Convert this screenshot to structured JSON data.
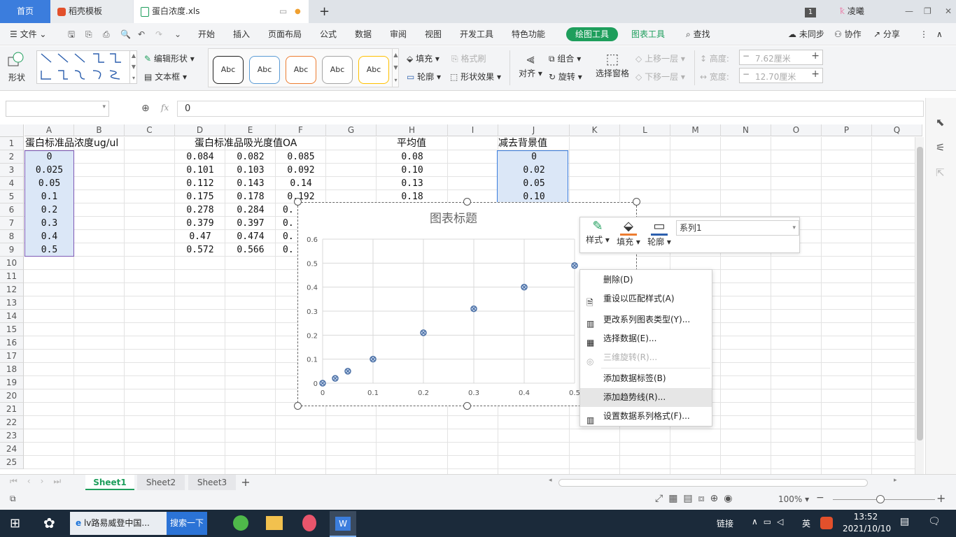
{
  "tabs": {
    "home": "首页",
    "template": "稻壳模板",
    "file": "蛋白浓度.xls",
    "user": "凌曦",
    "badge": "1"
  },
  "menubar": {
    "file": "文件",
    "items": [
      "开始",
      "插入",
      "页面布局",
      "公式",
      "数据",
      "审阅",
      "视图",
      "开发工具",
      "特色功能"
    ],
    "drawing_tools": "绘图工具",
    "chart_tools": "图表工具",
    "search": "查找",
    "sync": "未同步",
    "collab": "协作",
    "share": "分享"
  },
  "ribbon": {
    "shape": "形状",
    "edit_shape": "编辑形状",
    "textbox": "文本框",
    "style_samples": [
      "Abc",
      "Abc",
      "Abc",
      "Abc",
      "Abc"
    ],
    "fill": "填充",
    "format_painter": "格式刷",
    "outline": "轮廓",
    "shape_effects": "形状效果",
    "align": "对齐",
    "group": "组合",
    "rotate": "旋转",
    "selection_pane": "选择窗格",
    "bring_forward": "上移一层",
    "send_backward": "下移一层",
    "height_label": "高度:",
    "height_value": "7.62厘米",
    "width_label": "宽度:",
    "width_value": "12.70厘米"
  },
  "formula": {
    "name_box": "",
    "fx": "fx",
    "value": "0"
  },
  "columns": [
    "A",
    "B",
    "C",
    "D",
    "E",
    "F",
    "G",
    "H",
    "I",
    "J",
    "K",
    "L",
    "M",
    "N",
    "O",
    "P",
    "Q"
  ],
  "rows": [
    "1",
    "2",
    "3",
    "4",
    "5",
    "6",
    "7",
    "8",
    "9",
    "10",
    "11",
    "12",
    "13",
    "14",
    "15",
    "16",
    "17",
    "18",
    "19",
    "20",
    "21",
    "22",
    "23",
    "24",
    "25"
  ],
  "cells": {
    "a1": "蛋白标准品浓度ug/ul",
    "d1": "蛋白标准品吸光度值OA",
    "h1": "平均值",
    "j1": "减去背景值",
    "colA": [
      "0",
      "0.025",
      "0.05",
      "0.1",
      "0.2",
      "0.3",
      "0.4",
      "0.5"
    ],
    "colD": [
      "0.084",
      "0.101",
      "0.112",
      "0.175",
      "0.278",
      "0.379",
      "0.47",
      "0.572"
    ],
    "colE": [
      "0.082",
      "0.103",
      "0.143",
      "0.178",
      "0.284",
      "0.397",
      "0.474",
      "0.566"
    ],
    "colF": [
      "0.085",
      "0.092",
      "0.14",
      "0.192"
    ],
    "colF_partial": [
      "0.",
      "0.",
      "0.",
      "0."
    ],
    "colH": [
      "0.08",
      "0.10",
      "0.13",
      "0.18"
    ],
    "colJ": [
      "0",
      "0.02",
      "0.05",
      "0.10"
    ]
  },
  "chart_data": {
    "type": "scatter",
    "title": "图表标题",
    "xlabel": "",
    "ylabel": "",
    "xlim": [
      0,
      0.5
    ],
    "ylim": [
      0,
      0.6
    ],
    "x_ticks": [
      "0",
      "0.1",
      "0.2",
      "0.3",
      "0.4",
      "0.5"
    ],
    "y_ticks": [
      "0",
      "0.1",
      "0.2",
      "0.3",
      "0.4",
      "0.5",
      "0.6"
    ],
    "grid": true,
    "series": [
      {
        "name": "系列1",
        "x": [
          0,
          0.025,
          0.05,
          0.1,
          0.2,
          0.3,
          0.4,
          0.5
        ],
        "y": [
          0,
          0.02,
          0.05,
          0.1,
          0.21,
          0.31,
          0.4,
          0.49
        ]
      }
    ],
    "marker_color": "#4a6fa5"
  },
  "chart_toolbar": {
    "style": "样式",
    "fill": "填充",
    "outline": "轮廓",
    "series_select": "系列1"
  },
  "context_menu": {
    "items": [
      {
        "label": "删除(D)",
        "disabled": false
      },
      {
        "label": "重设以匹配样式(A)",
        "disabled": false
      },
      {
        "label": "更改系列图表类型(Y)...",
        "disabled": false
      },
      {
        "label": "选择数据(E)...",
        "disabled": false
      },
      {
        "label": "三维旋转(R)...",
        "disabled": true
      },
      {
        "label": "添加数据标签(B)",
        "disabled": false
      },
      {
        "label": "添加趋势线(R)...",
        "disabled": false
      },
      {
        "label": "设置数据系列格式(F)...",
        "disabled": false
      }
    ]
  },
  "sheets": [
    "Sheet1",
    "Sheet2",
    "Sheet3"
  ],
  "statusbar": {
    "zoom": "100%"
  },
  "taskbar": {
    "browser_text": "lv路易威登中国...",
    "search_btn": "搜索一下",
    "link": "链接",
    "ime": "英",
    "time": "13:52",
    "date": "2021/10/10"
  },
  "colors": {
    "accent_green": "#1e9e5c",
    "selection": "#dbe7f7",
    "chart_accent": "#4a6fa5"
  }
}
